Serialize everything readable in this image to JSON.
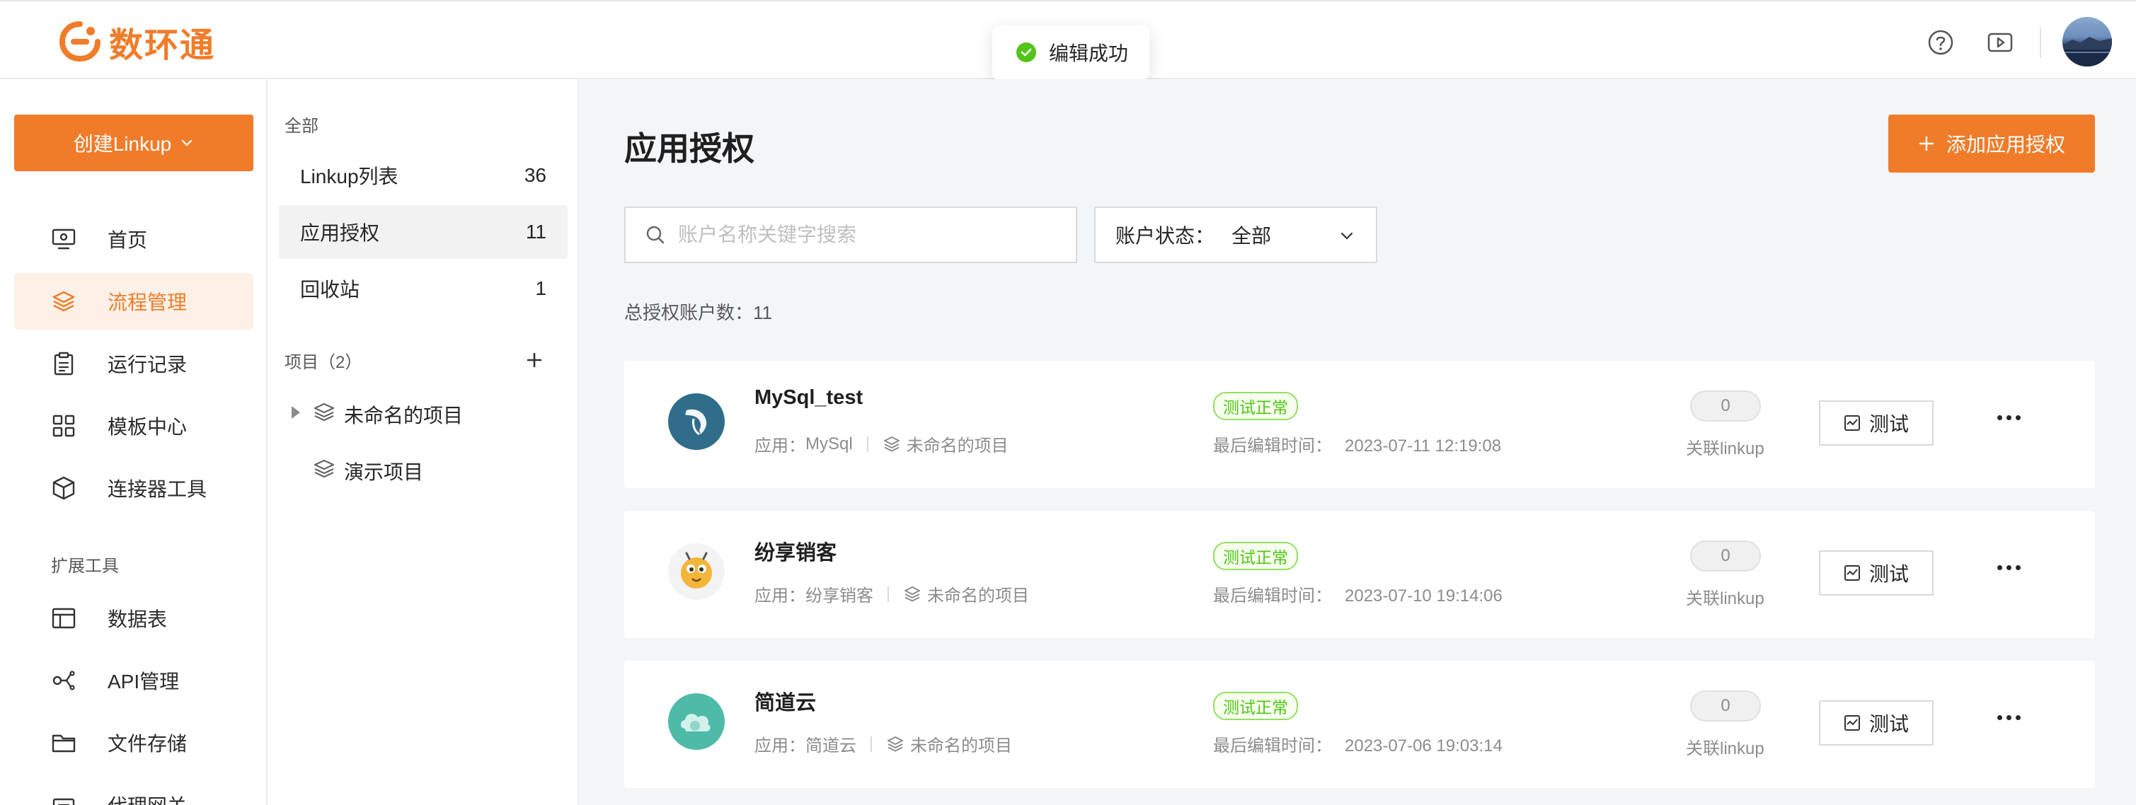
{
  "brand": {
    "name": "数环通",
    "color": "#f07c2a"
  },
  "toast": {
    "text": "编辑成功",
    "icon": "check-circle-icon"
  },
  "header": {
    "icons": [
      "help-icon",
      "video-icon"
    ],
    "avatar": "user-avatar"
  },
  "sidebar": {
    "create_button": "创建Linkup",
    "items": [
      {
        "label": "首页",
        "icon": "monitor-icon",
        "active": false
      },
      {
        "label": "流程管理",
        "icon": "layers-icon",
        "active": true
      },
      {
        "label": "运行记录",
        "icon": "clipboard-icon",
        "active": false
      },
      {
        "label": "模板中心",
        "icon": "grid-icon",
        "active": false
      },
      {
        "label": "连接器工具",
        "icon": "cube-icon",
        "active": false
      }
    ],
    "ext_title": "扩展工具",
    "ext_items": [
      {
        "label": "数据表",
        "icon": "table-icon"
      },
      {
        "label": "API管理",
        "icon": "api-icon"
      },
      {
        "label": "文件存储",
        "icon": "folder-icon"
      },
      {
        "label": "代理网关",
        "icon": "gateway-icon"
      }
    ]
  },
  "panel": {
    "all_title": "全部",
    "items": [
      {
        "label": "Linkup列表",
        "count": "36",
        "active": false
      },
      {
        "label": "应用授权",
        "count": "11",
        "active": true
      },
      {
        "label": "回收站",
        "count": "1",
        "active": false
      }
    ],
    "projects_title": "项目（2）",
    "projects": [
      {
        "label": "未命名的项目",
        "expandable": true
      },
      {
        "label": "演示项目",
        "expandable": false
      }
    ]
  },
  "main": {
    "title": "应用授权",
    "add_button": "添加应用授权",
    "search_placeholder": "账户名称关键字搜索",
    "status_filter": {
      "label": "账户状态：",
      "value": "全部"
    },
    "total_label": "总授权账户数：11",
    "meta_app_prefix": "应用：",
    "edit_time_label": "最后编辑时间：",
    "linkup_label": "关联linkup",
    "test_button": "测试",
    "accounts": [
      {
        "name": "MySql_test",
        "app": "MySql",
        "project": "未命名的项目",
        "status": "测试正常",
        "edited": "2023-07-11 12:19:08",
        "linkups": "0",
        "logo_color": "#2f6d8a"
      },
      {
        "name": "纷享销客",
        "app": "纷享销客",
        "project": "未命名的项目",
        "status": "测试正常",
        "edited": "2023-07-10 19:14:06",
        "linkups": "0",
        "logo_color": "#f3b53a"
      },
      {
        "name": "简道云",
        "app": "简道云",
        "project": "未命名的项目",
        "status": "测试正常",
        "edited": "2023-07-06 19:03:14",
        "linkups": "0",
        "logo_color": "#4dbba8"
      }
    ]
  }
}
